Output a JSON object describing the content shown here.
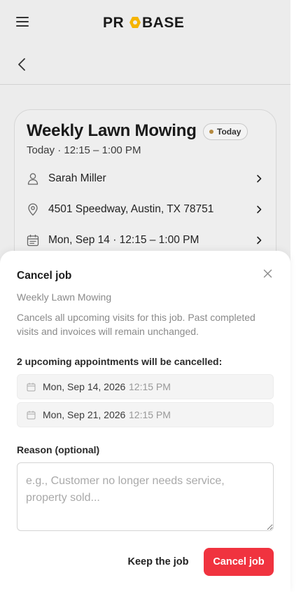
{
  "app": {
    "logo_text": "PROBASE",
    "brand_color": "#f5b400"
  },
  "job_card": {
    "title": "Weekly Lawn Mowing",
    "badge": "Today",
    "badge_dot_color": "#b5893f",
    "schedule": "Today · 12:15 – 1:00 PM",
    "rows": [
      {
        "icon": "person-icon",
        "text": "Sarah Miller"
      },
      {
        "icon": "location-pin-icon",
        "text": "4501 Speedway, Austin, TX 78751"
      },
      {
        "icon": "calendar-icon",
        "text": "Mon, Sep 14 · 12:15 – 1:00 PM"
      }
    ]
  },
  "cancel_sheet": {
    "title": "Cancel job",
    "job_name": "Weekly Lawn Mowing",
    "description": "Cancels all upcoming visits for this job. Past completed visits and invoices will remain unchanged.",
    "appointments_heading": "2 upcoming appointments will be cancelled:",
    "appointments": [
      {
        "date": "Mon, Sep 14, 2026",
        "time": "12:15 PM"
      },
      {
        "date": "Mon, Sep 21, 2026",
        "time": "12:15 PM"
      }
    ],
    "reason_label": "Reason (optional)",
    "reason_placeholder": "e.g., Customer no longer needs service, property sold...",
    "reason_value": "",
    "keep_label": "Keep the job",
    "cancel_label": "Cancel job",
    "cancel_color": "#f0333f"
  }
}
